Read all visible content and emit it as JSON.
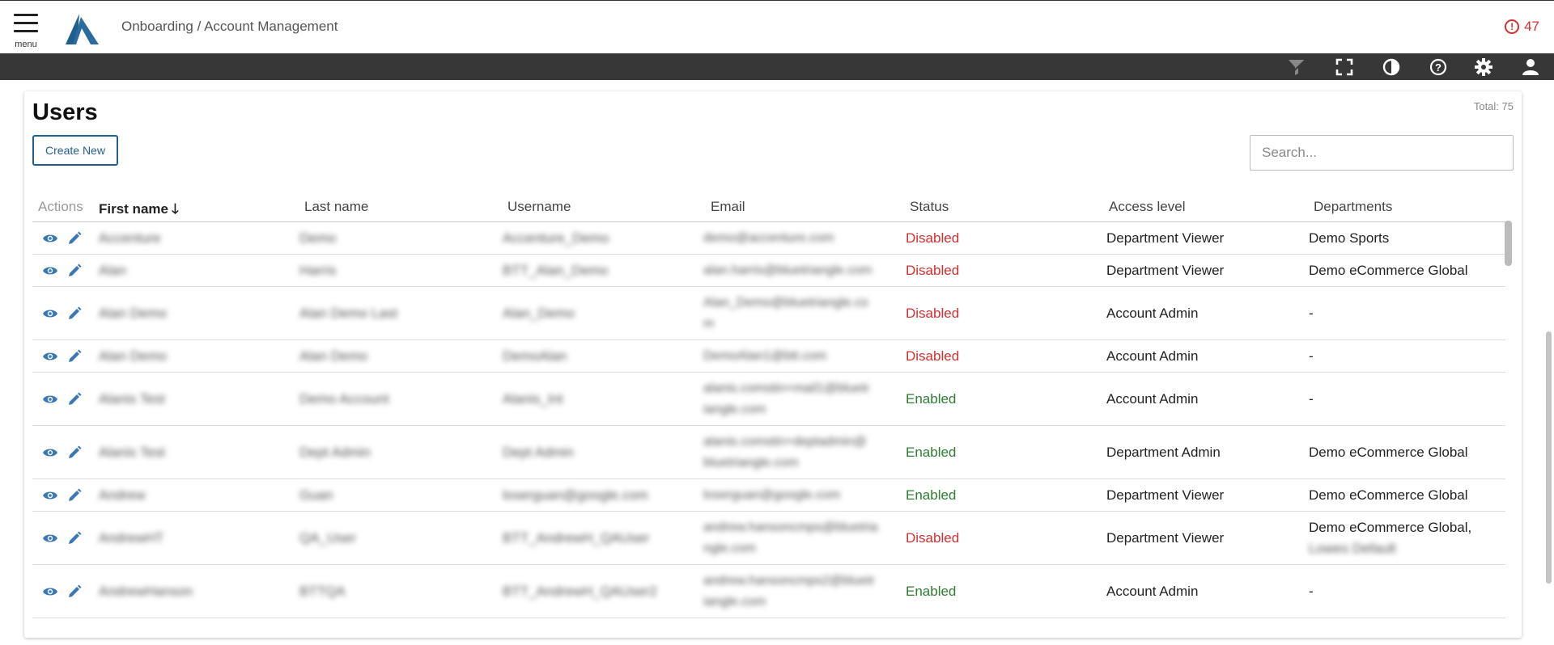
{
  "header": {
    "menu_label": "menu",
    "breadcrumb": "Onboarding / Account Management",
    "alert_count": "47"
  },
  "toolbar": {
    "icons": [
      "filter-icon",
      "fullscreen-icon",
      "contrast-icon",
      "help-icon",
      "settings-icon",
      "user-icon"
    ]
  },
  "page": {
    "title": "Users",
    "total": "Total: 75",
    "create_label": "Create New",
    "search_placeholder": "Search..."
  },
  "table": {
    "columns": [
      "Actions",
      "First name",
      "Last name",
      "Username",
      "Email",
      "Status",
      "Access level",
      "Departments"
    ],
    "sort_indicator": "🡓",
    "rows": [
      {
        "first": "Accenture",
        "last": "Demo",
        "username": "Accenture_Demo",
        "email": "demo@accenture.com",
        "email2": "",
        "status": "Disabled",
        "access": "Department Viewer",
        "dept": "Demo Sports",
        "dept2": ""
      },
      {
        "first": "Alan",
        "last": "Harris",
        "username": "BTT_Alan_Demo",
        "email": "alan.harris@bluetriangle.com",
        "email2": "",
        "status": "Disabled",
        "access": "Department Viewer",
        "dept": "Demo eCommerce Global",
        "dept2": ""
      },
      {
        "first": "Alan Demo",
        "last": "Alan Demo Last",
        "username": "Alan_Demo",
        "email": "Alan_Demo@bluetriangle.co",
        "email2": "m",
        "status": "Disabled",
        "access": "Account Admin",
        "dept": "-",
        "dept2": ""
      },
      {
        "first": "Alan Demo",
        "last": "Alan Demo",
        "username": "DemoAlan",
        "email": "DemoAlan1@btt.com",
        "email2": "",
        "status": "Disabled",
        "access": "Account Admin",
        "dept": "-",
        "dept2": ""
      },
      {
        "first": "Alanis Test",
        "last": "Demo Account",
        "username": "Alanis_Int",
        "email": "alanis.comstin+mail1@bluetr",
        "email2": "iangle.com",
        "status": "Enabled",
        "access": "Account Admin",
        "dept": "-",
        "dept2": ""
      },
      {
        "first": "Alanis Test",
        "last": "Dept Admin",
        "username": "Dept Admin",
        "email": "alanis.comstin+deptadmin@",
        "email2": "bluetriangle.com",
        "status": "Enabled",
        "access": "Department Admin",
        "dept": "Demo eCommerce Global",
        "dept2": ""
      },
      {
        "first": "Andrew",
        "last": "Guan",
        "username": "loserguan@google.com",
        "email": "loserguan@google.com",
        "email2": "",
        "status": "Enabled",
        "access": "Department Viewer",
        "dept": "Demo eCommerce Global",
        "dept2": ""
      },
      {
        "first": "AndrewHT",
        "last": "QA_User",
        "username": "BTT_AndrewH_QAUser",
        "email": "andrew.hansoncmps@bluetria",
        "email2": "ngle.com",
        "status": "Disabled",
        "access": "Department Viewer",
        "dept": "Demo eCommerce Global,",
        "dept2": "Lowes Default"
      },
      {
        "first": "AndrewHanson",
        "last": "BTTQA",
        "username": "BTT_AndrewH_QAUser2",
        "email": "andrew.hansoncmps2@bluetr",
        "email2": "iangle.com",
        "status": "Enabled",
        "access": "Account Admin",
        "dept": "-",
        "dept2": ""
      }
    ]
  },
  "colors": {
    "toolbar": "#373737",
    "accent": "#1f5f8f",
    "disabled": "#d32f2f",
    "enabled": "#2e7d32",
    "action_icon": "#3a78b5"
  }
}
